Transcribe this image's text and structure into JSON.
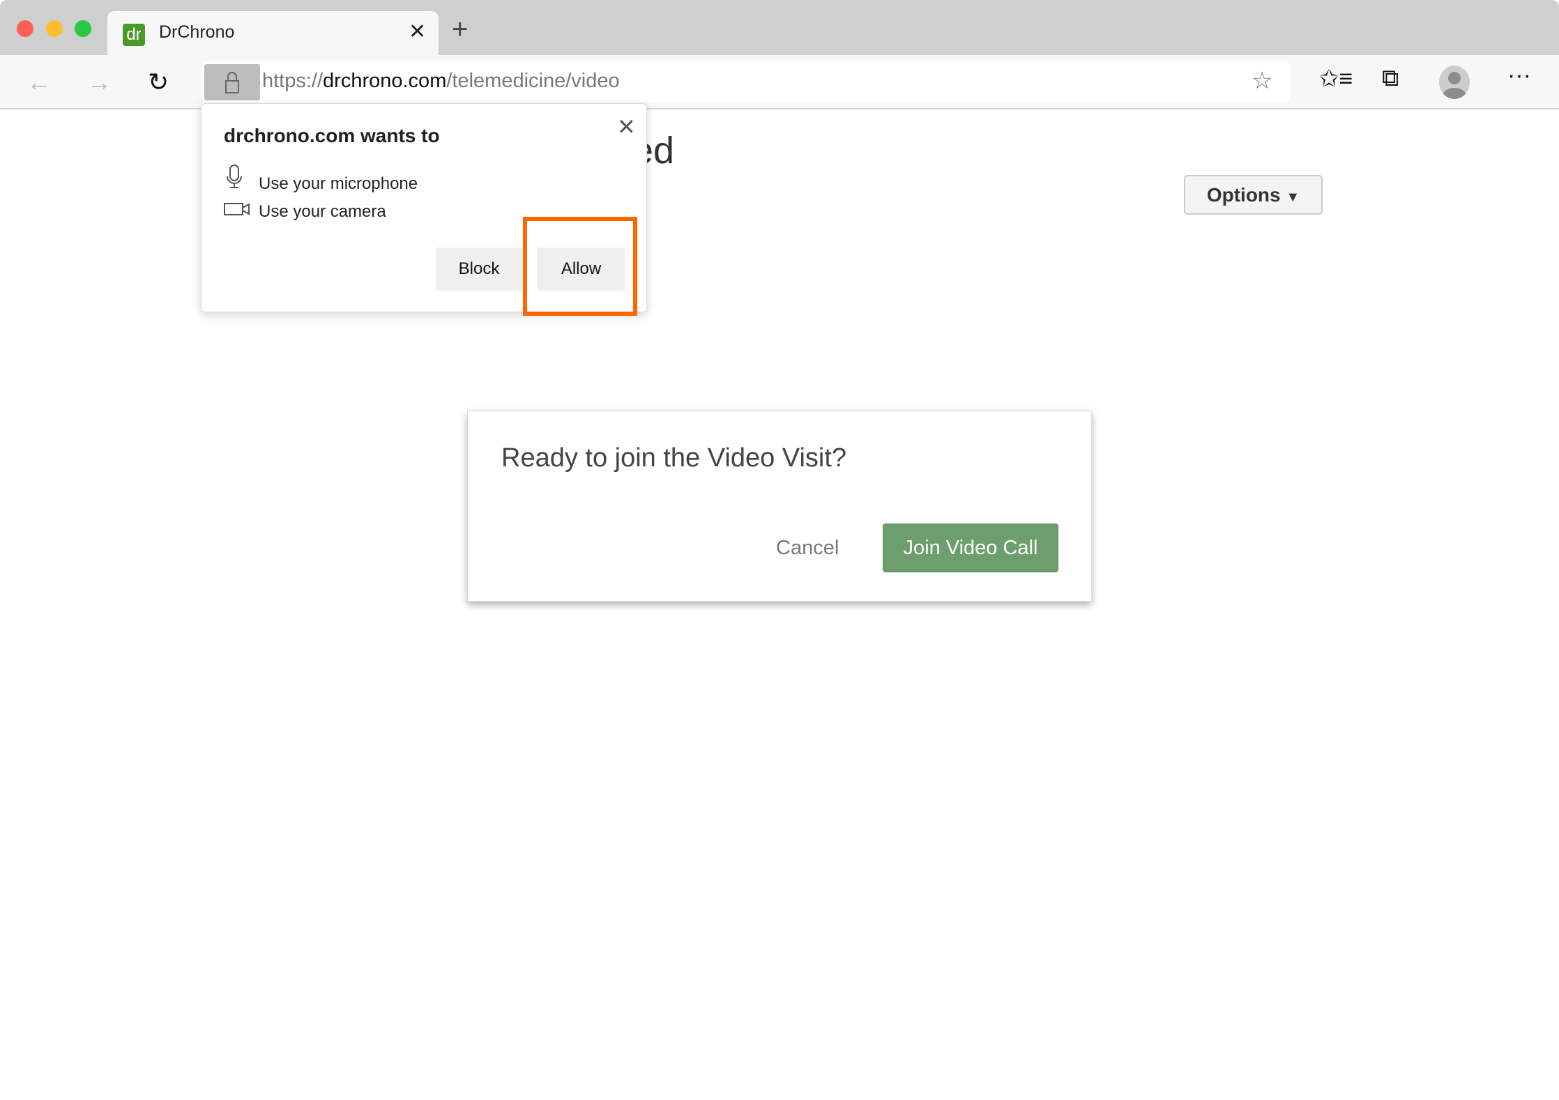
{
  "browser": {
    "tab": {
      "title": "DrChrono",
      "favicon_text": "dr",
      "close_icon": "close-icon"
    },
    "new_tab_icon": "plus-icon",
    "url": {
      "scheme": "https://",
      "host": "drchrono.com",
      "path": "/telemedicine/video"
    },
    "icons": [
      "back-icon",
      "forward-icon",
      "refresh-icon",
      "lock-icon",
      "add-favorite-icon",
      "favorites-icon",
      "collections-icon",
      "profile-icon",
      "more-icon"
    ]
  },
  "page": {
    "heading_visible": "ed",
    "options_label": "Options"
  },
  "permission_popup": {
    "title": "drchrono.com wants to",
    "items": [
      {
        "icon": "microphone-icon",
        "label": "Use your microphone"
      },
      {
        "icon": "camera-icon",
        "label": "Use your camera"
      }
    ],
    "block_label": "Block",
    "allow_label": "Allow",
    "highlight_color": "#ff6600"
  },
  "dialog": {
    "title": "Ready to join the Video Visit?",
    "cancel_label": "Cancel",
    "join_label": "Join Video Call",
    "join_color": "#6d9e6d"
  }
}
